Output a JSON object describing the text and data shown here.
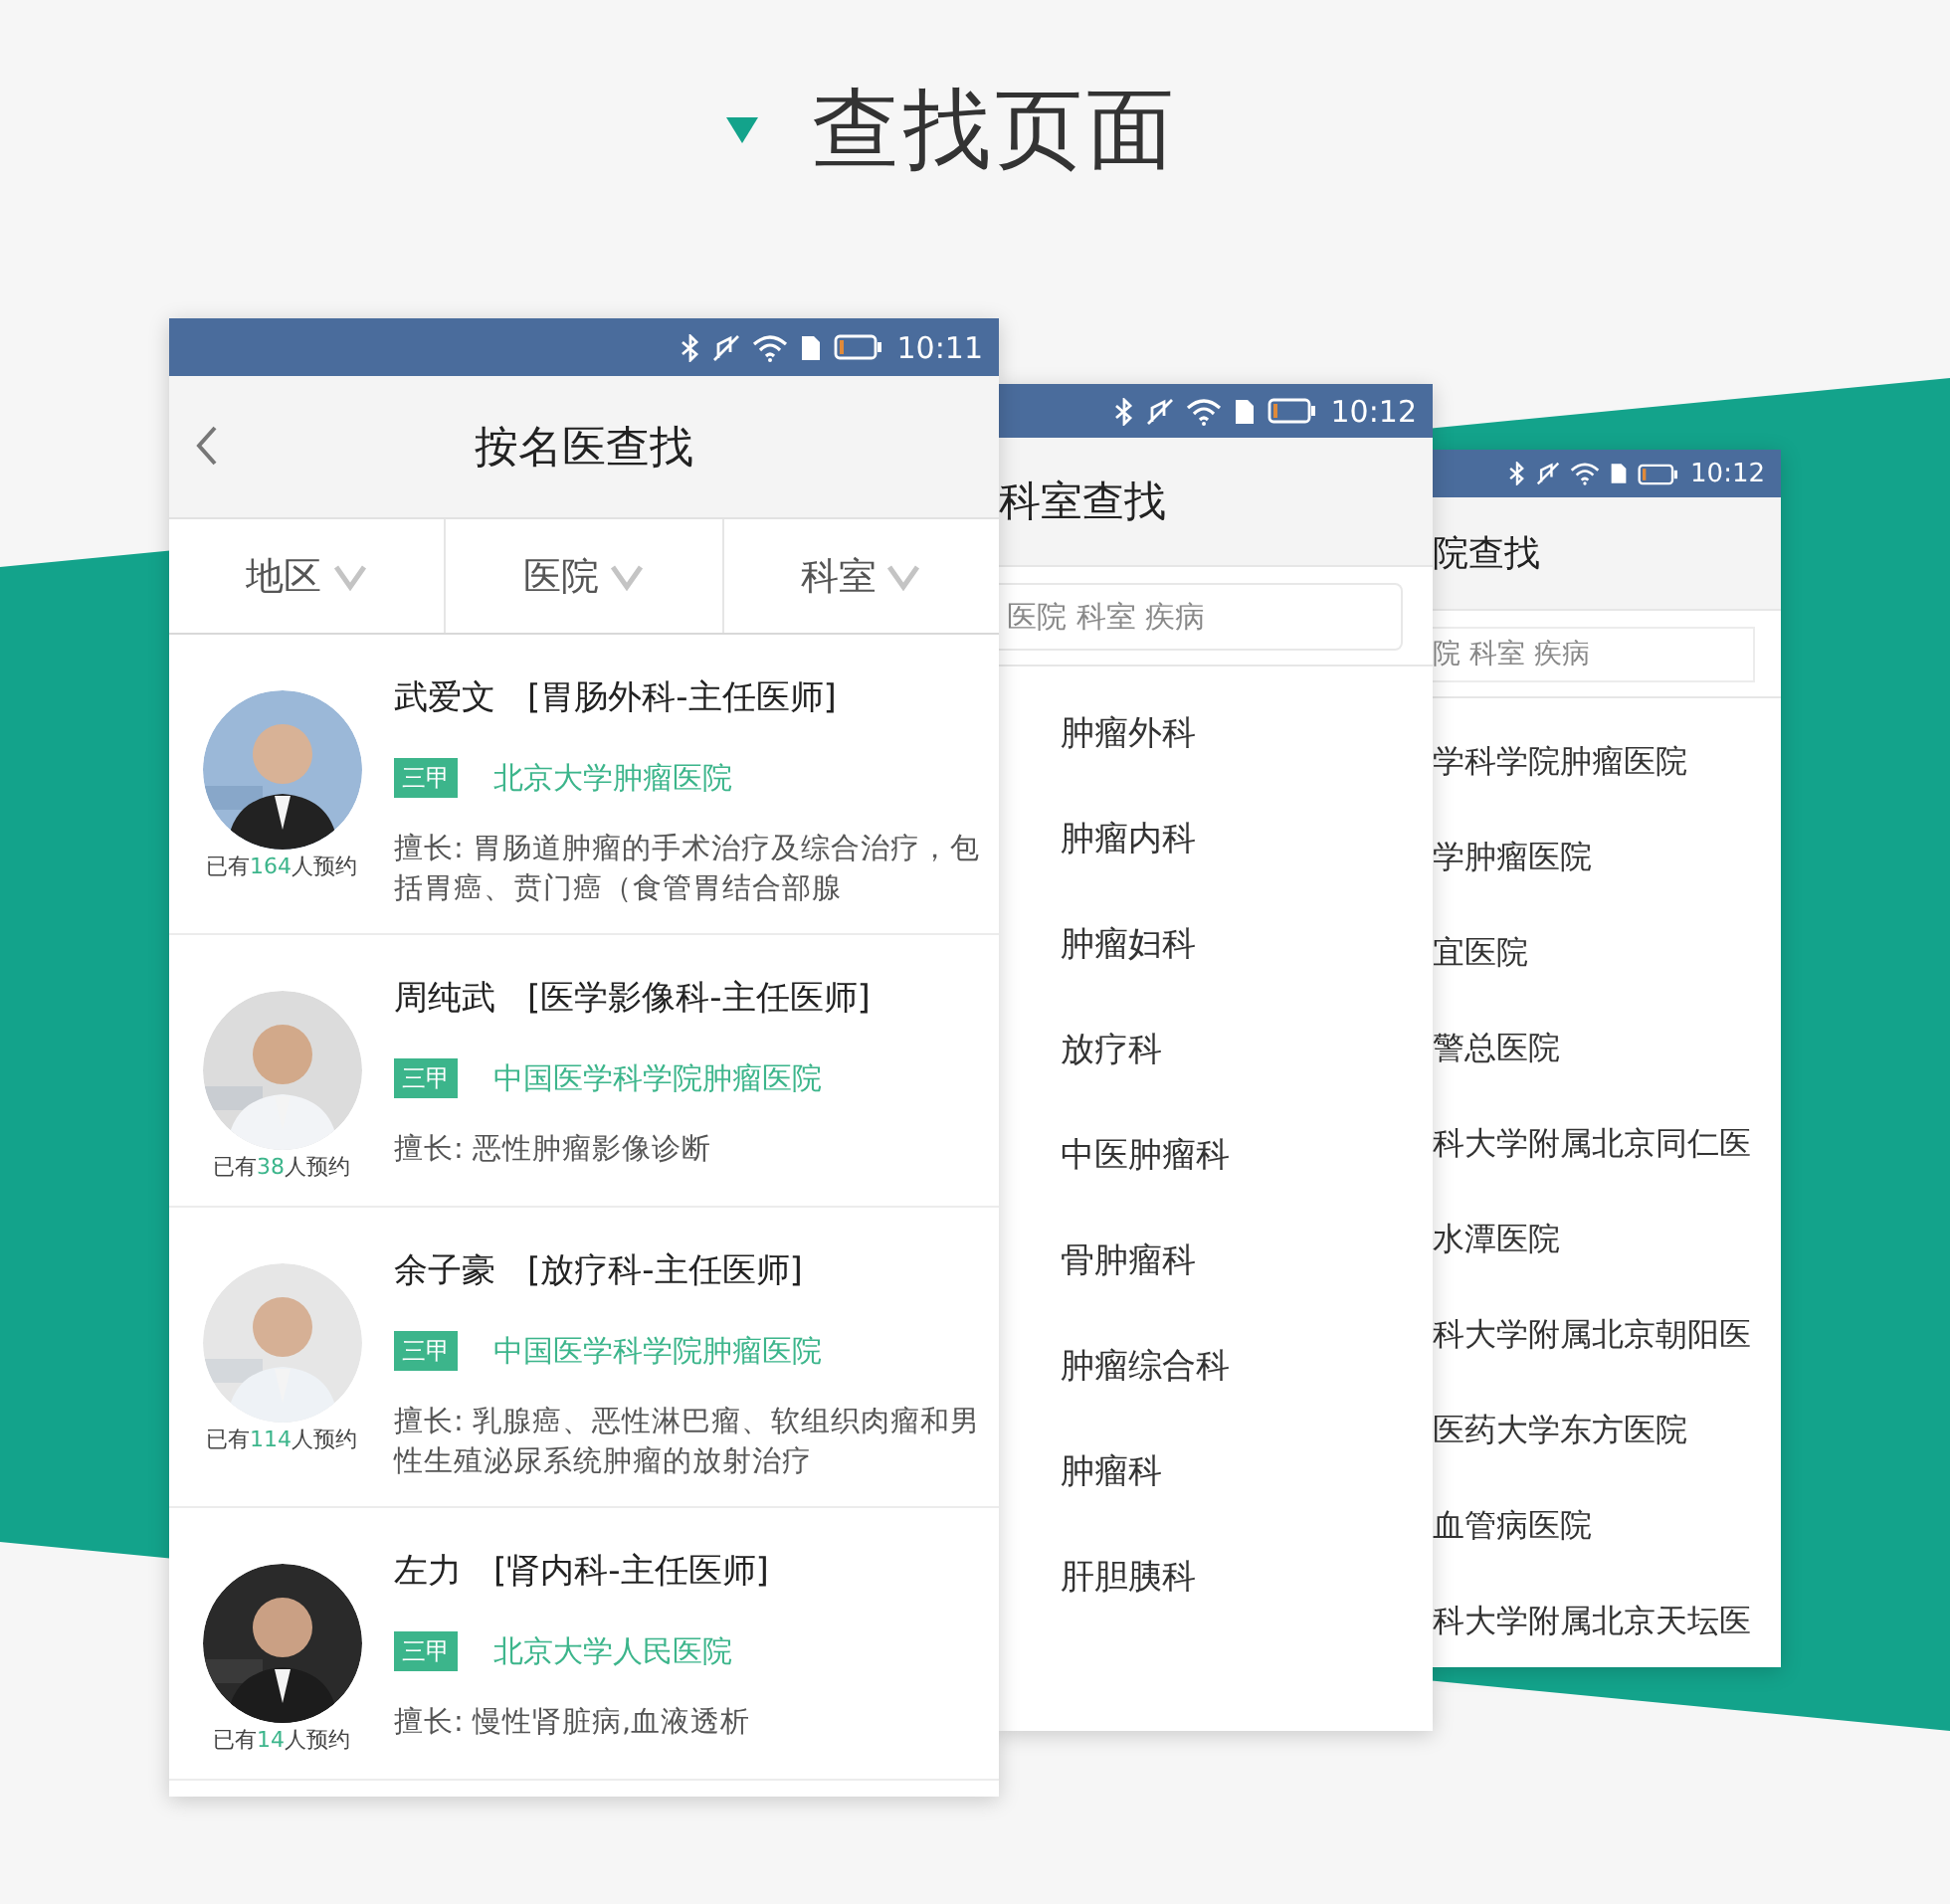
{
  "heading": {
    "title": "查找页面"
  },
  "doctor_screen": {
    "status_bar": {
      "time": "10:11"
    },
    "title": "按名医查找",
    "filters": [
      {
        "label": "地区"
      },
      {
        "label": "医院"
      },
      {
        "label": "科室"
      }
    ],
    "doctors": [
      {
        "name": "武爱文",
        "position": "[胃肠外科-主任医师]",
        "grade": "三甲",
        "hospital": "北京大学肿瘤医院",
        "specialty": "擅长: 胃肠道肿瘤的手术治疗及综合治疗，包括胃癌、贲门癌（食管胃结合部腺",
        "booked_prefix": "已有",
        "booked_count": "164",
        "booked_suffix": "人预约"
      },
      {
        "name": "周纯武",
        "position": "[医学影像科-主任医师]",
        "grade": "三甲",
        "hospital": "中国医学科学院肿瘤医院",
        "specialty": "擅长: 恶性肿瘤影像诊断",
        "booked_prefix": "已有",
        "booked_count": "38",
        "booked_suffix": "人预约"
      },
      {
        "name": "余子豪",
        "position": "[放疗科-主任医师]",
        "grade": "三甲",
        "hospital": "中国医学科学院肿瘤医院",
        "specialty": "擅长: 乳腺癌、恶性淋巴瘤、软组织肉瘤和男性生殖泌尿系统肿瘤的放射治疗",
        "booked_prefix": "已有",
        "booked_count": "114",
        "booked_suffix": "人预约"
      },
      {
        "name": "左力",
        "position": "[肾内科-主任医师]",
        "grade": "三甲",
        "hospital": "北京大学人民医院",
        "specialty": "擅长: 慢性肾脏病,血液透析",
        "booked_prefix": "已有",
        "booked_count": "14",
        "booked_suffix": "人预约"
      }
    ]
  },
  "department_screen": {
    "status_bar": {
      "time": "10:12"
    },
    "title": "科室查找",
    "search": {
      "placeholder": "医院 科室 疾病"
    },
    "departments": [
      "肿瘤外科",
      "肿瘤内科",
      "肿瘤妇科",
      "放疗科",
      "中医肿瘤科",
      "骨肿瘤科",
      "肿瘤综合科",
      "肿瘤科",
      "肝胆胰科"
    ]
  },
  "hospital_screen": {
    "status_bar": {
      "time": "10:12"
    },
    "title": "院查找",
    "search": {
      "placeholder": "院 科室 疾病"
    },
    "hospitals": [
      "学科学院肿瘤医院",
      "学肿瘤医院",
      "宜医院",
      "警总医院",
      "科大学附属北京同仁医",
      "水潭医院",
      "科大学附属北京朝阳医",
      "医药大学东方医院",
      "血管病医院",
      "科大学附属北京天坛医"
    ]
  }
}
